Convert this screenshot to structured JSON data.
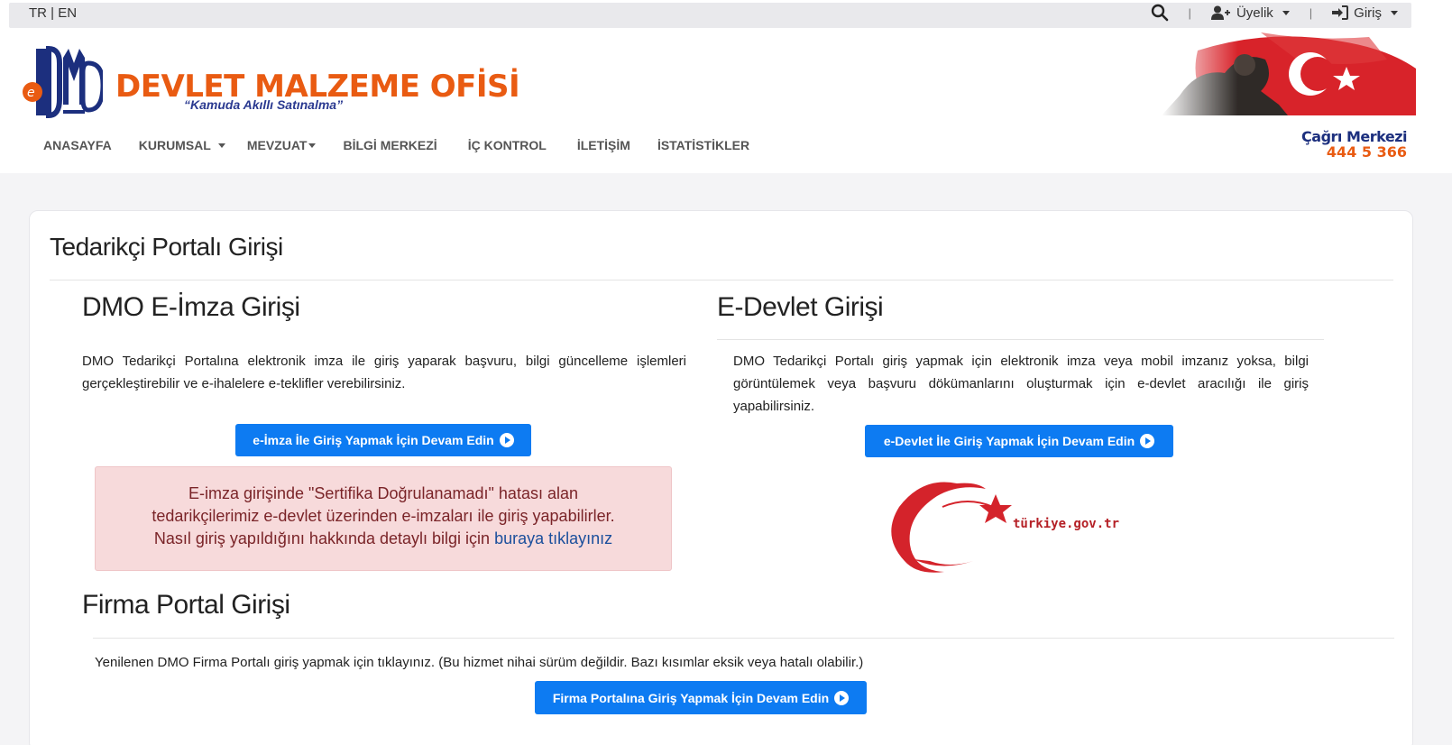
{
  "topbar": {
    "lang_tr": "TR",
    "lang_sep": "|",
    "lang_en": "EN",
    "sep": "|",
    "uyelik": "Üyelik",
    "giris": "Giriş"
  },
  "header": {
    "brand": "DEVLET MALZEME OFİSİ",
    "slogan": "“Kamuda Akıllı Satınalma”",
    "call_title": "Çağrı Merkezi",
    "call_number": "444 5 366"
  },
  "nav": {
    "items": [
      {
        "label": "ANASAYFA",
        "dropdown": false
      },
      {
        "label": "KURUMSAL",
        "dropdown": true
      },
      {
        "label": "MEVZUAT",
        "dropdown": true
      },
      {
        "label": "BİLGİ MERKEZİ",
        "dropdown": false
      },
      {
        "label": "İÇ KONTROL",
        "dropdown": false
      },
      {
        "label": "İLETİŞİM",
        "dropdown": false
      },
      {
        "label": "İSTATİSTİKLER",
        "dropdown": false
      }
    ]
  },
  "card": {
    "title": "Tedarikçi Portalı Girişi"
  },
  "eimza": {
    "title": "DMO E-İmza Girişi",
    "text": "DMO Tedarikçi Portalına elektronik imza ile giriş yaparak başvuru, bilgi güncelleme işlemleri gerçekleştirebilir ve e-ihalelere e-teklifler verebilirsiniz.",
    "button": "e-İmza İle Giriş Yapmak İçin Devam Edin"
  },
  "alert": {
    "line1": "E-imza girişinde \"Sertifika Doğrulanamadı\" hatası alan",
    "line2": "tedarikçilerimiz e-devlet üzerinden e-imzaları ile giriş yapabilirler.",
    "line3": "Nasıl giriş yapıldığını hakkında detaylı bilgi için",
    "link": "buraya tıklayınız"
  },
  "edevlet": {
    "title": "E-Devlet Girişi",
    "text": "DMO Tedarikçi Portalı giriş yapmak için elektronik imza veya mobil imzanız yoksa, bilgi görüntülemek veya başvuru dökümanlarını oluşturmak için e-devlet aracılığı ile giriş yapabilirsiniz.",
    "button": "e-Devlet İle Giriş Yapmak İçin Devam Edin",
    "logo_text": "türkiye.gov.tr"
  },
  "firma": {
    "title": "Firma Portal Girişi",
    "text": "Yenilenen DMO Firma Portalı giriş yapmak için tıklayınız. (Bu hizmet nihai sürüm değildir. Bazı kısımlar eksik veya hatalı olabilir.)",
    "button": "Firma Portalına Giriş Yapmak İçin Devam Edin"
  },
  "colors": {
    "brand_orange": "#e95b12",
    "brand_navy": "#1c2f7e",
    "button_blue": "#0d7bf2",
    "alert_bg": "#f7dadb"
  }
}
